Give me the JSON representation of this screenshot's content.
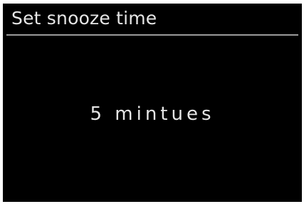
{
  "screen": {
    "title": "Set snooze time",
    "value": "5 mintues",
    "colors": {
      "background": "#000000",
      "text": "#e6e6e6",
      "divider": "#9a9a9a"
    }
  }
}
